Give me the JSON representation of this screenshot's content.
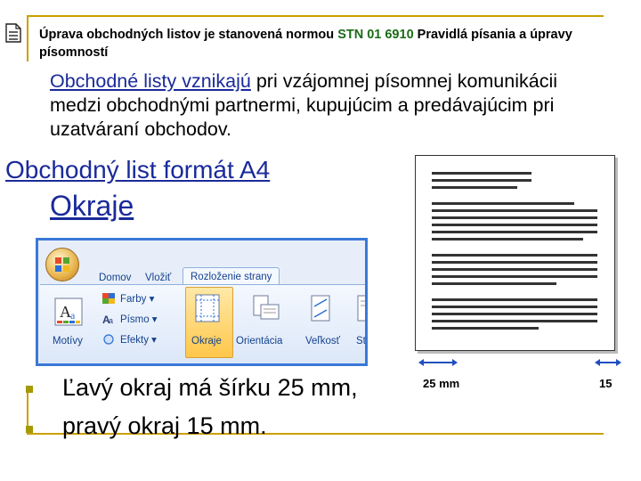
{
  "header": {
    "title_part1": "Úprava obchodných listov  je stanovená normou ",
    "title_norm": "STN 01 6910",
    "title_part2": " Pravidlá písania a úpravy  písomností"
  },
  "intro": {
    "lead": "Obchodné listy vznikajú",
    "rest": " pri vzájomnej písomnej komunikácii medzi obchodnými partnermi, kupujúcim a predávajúcim pri uzatváraní obchodov."
  },
  "headings": {
    "format": "Obchodný list formát A4",
    "margins": "Okraje"
  },
  "ribbon": {
    "tabs": [
      "Domov",
      "Vložiť",
      "Rozloženie strany"
    ],
    "active_tab": "Rozloženie strany",
    "theme_group": {
      "motivy": "Motívy",
      "farby": "Farby ▾",
      "pismo": "Písmo ▾",
      "efekty": "Efekty ▾"
    },
    "page_setup": {
      "okraje": "Okraje",
      "orientacia": "Orientácia",
      "velkost": "Veľkosť",
      "stlpce": "Stĺ"
    }
  },
  "preview": {
    "left_margin_label": "25 mm",
    "right_margin_label": "15"
  },
  "bullets": [
    "Ľavý okraj má šírku 25 mm,",
    "pravý okraj 15 mm."
  ],
  "colors": {
    "heading_blue": "#1a2a9a",
    "norm_green": "#1b6b17",
    "accent_gold": "#c9a000",
    "bullet_olive": "#a49a00",
    "arrow_blue": "#1f4fbf"
  }
}
